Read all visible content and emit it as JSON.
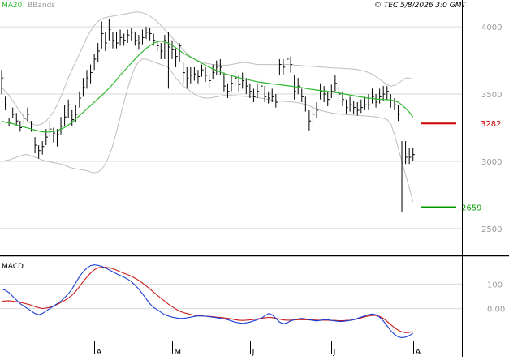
{
  "header": {
    "ma_label": "MA20",
    "bb_label": "BBands",
    "copyright": "© TEC 5/8/2026 3:0 GMT"
  },
  "colors": {
    "price_bar": "#000000",
    "ma20": "#2db82d",
    "bbands": "#bdbdbd",
    "resistance": "#cc0000",
    "support": "#009900",
    "macd_line": "#1f3fd6",
    "signal_line": "#cc1a1a",
    "grid": "#d9d9d9",
    "axis_label": "#999999",
    "frame": "#000000"
  },
  "chart_data": [
    {
      "type": "ohlc",
      "panel": "price",
      "title": "",
      "x": {
        "month_labels": [
          {
            "label": "A",
            "index": 25
          },
          {
            "label": "M",
            "index": 46
          },
          {
            "label": "J",
            "index": 67
          },
          {
            "label": "J",
            "index": 89
          },
          {
            "label": "A",
            "index": 111
          }
        ],
        "bar_count": 112
      },
      "y": {
        "ticks": [
          2500,
          3000,
          3500,
          4000
        ],
        "tick_labels": [
          "2500",
          "3000",
          "3500",
          "4000"
        ],
        "ylim": [
          2300,
          4200
        ]
      },
      "levels": {
        "resistance": {
          "value": 3282,
          "label": "3282"
        },
        "support": {
          "value": 2659,
          "label": "2659"
        }
      },
      "series": [
        {
          "name": "MA20",
          "values": [
            3300,
            3290,
            3285,
            3280,
            3270,
            3262,
            3255,
            3248,
            3240,
            3232,
            3225,
            3220,
            3218,
            3218,
            3222,
            3228,
            3238,
            3252,
            3270,
            3290,
            3315,
            3340,
            3365,
            3390,
            3415,
            3440,
            3465,
            3490,
            3515,
            3545,
            3575,
            3605,
            3640,
            3670,
            3700,
            3730,
            3760,
            3790,
            3815,
            3840,
            3860,
            3878,
            3890,
            3895,
            3890,
            3878,
            3862,
            3845,
            3825,
            3805,
            3790,
            3775,
            3760,
            3745,
            3730,
            3715,
            3700,
            3688,
            3676,
            3665,
            3655,
            3645,
            3637,
            3630,
            3622,
            3616,
            3610,
            3604,
            3598,
            3592,
            3588,
            3584,
            3580,
            3576,
            3573,
            3570,
            3566,
            3563,
            3560,
            3556,
            3552,
            3548,
            3543,
            3538,
            3534,
            3530,
            3527,
            3524,
            3520,
            3516,
            3512,
            3508,
            3503,
            3498,
            3493,
            3488,
            3483,
            3478,
            3474,
            3470,
            3467,
            3464,
            3462,
            3460,
            3458,
            3456,
            3450,
            3440,
            3420,
            3395,
            3365,
            3330
          ]
        },
        {
          "name": "BB upper",
          "values": [
            3550,
            3520,
            3490,
            3450,
            3410,
            3370,
            3330,
            3300,
            3280,
            3270,
            3270,
            3280,
            3300,
            3330,
            3370,
            3420,
            3480,
            3550,
            3620,
            3680,
            3740,
            3800,
            3860,
            3920,
            3970,
            4010,
            4040,
            4060,
            4070,
            4075,
            4080,
            4085,
            4090,
            4095,
            4100,
            4105,
            4110,
            4110,
            4105,
            4095,
            4080,
            4060,
            4040,
            4010,
            3980,
            3950,
            3920,
            3890,
            3860,
            3830,
            3800,
            3780,
            3760,
            3750,
            3740,
            3730,
            3725,
            3720,
            3718,
            3716,
            3715,
            3715,
            3720,
            3725,
            3730,
            3735,
            3735,
            3730,
            3725,
            3720,
            3720,
            3720,
            3720,
            3720,
            3720,
            3720,
            3720,
            3720,
            3718,
            3716,
            3714,
            3712,
            3710,
            3708,
            3706,
            3704,
            3702,
            3700,
            3698,
            3696,
            3694,
            3693,
            3692,
            3690,
            3688,
            3686,
            3682,
            3676,
            3670,
            3660,
            3648,
            3630,
            3610,
            3590,
            3570,
            3560,
            3565,
            3580,
            3600,
            3620,
            3620,
            3610
          ]
        },
        {
          "name": "BB lower",
          "values": [
            3000,
            3005,
            3010,
            3020,
            3030,
            3040,
            3050,
            3050,
            3040,
            3030,
            3020,
            3010,
            3000,
            2995,
            2990,
            2985,
            2980,
            2970,
            2960,
            2950,
            2945,
            2940,
            2935,
            2930,
            2920,
            2915,
            2920,
            2940,
            2980,
            3040,
            3120,
            3220,
            3330,
            3440,
            3540,
            3630,
            3700,
            3740,
            3760,
            3760,
            3750,
            3740,
            3730,
            3720,
            3710,
            3700,
            3660,
            3620,
            3590,
            3560,
            3540,
            3520,
            3500,
            3485,
            3475,
            3470,
            3470,
            3475,
            3480,
            3485,
            3490,
            3490,
            3490,
            3488,
            3486,
            3484,
            3482,
            3480,
            3478,
            3474,
            3470,
            3465,
            3460,
            3455,
            3450,
            3448,
            3446,
            3444,
            3442,
            3440,
            3436,
            3430,
            3422,
            3412,
            3400,
            3390,
            3380,
            3372,
            3366,
            3360,
            3356,
            3352,
            3350,
            3348,
            3346,
            3344,
            3342,
            3340,
            3338,
            3336,
            3334,
            3330,
            3325,
            3320,
            3310,
            3280,
            3200,
            3100,
            3000,
            2900,
            2800,
            2700
          ]
        }
      ],
      "close": [
        3620,
        3420,
        3290,
        3350,
        3300,
        3250,
        3320,
        3350,
        3260,
        3120,
        3080,
        3110,
        3180,
        3240,
        3210,
        3200,
        3260,
        3330,
        3420,
        3310,
        3350,
        3470,
        3550,
        3620,
        3660,
        3760,
        3820,
        3950,
        3880,
        3980,
        3900,
        3880,
        3920,
        3900,
        3940,
        3960,
        3900,
        3880,
        3920,
        3960,
        3950,
        3900,
        3860,
        3820,
        3900,
        3850,
        3830,
        3780,
        3860,
        3660,
        3620,
        3640,
        3650,
        3630,
        3680,
        3640,
        3600,
        3660,
        3700,
        3700,
        3560,
        3520,
        3580,
        3620,
        3570,
        3600,
        3560,
        3520,
        3480,
        3520,
        3560,
        3480,
        3470,
        3480,
        3440,
        3720,
        3700,
        3760,
        3720,
        3520,
        3560,
        3480,
        3420,
        3300,
        3350,
        3380,
        3520,
        3500,
        3460,
        3520,
        3580,
        3500,
        3460,
        3400,
        3420,
        3400,
        3380,
        3400,
        3420,
        3420,
        3480,
        3440,
        3480,
        3500,
        3520,
        3450,
        3420,
        3350,
        3100,
        3030,
        3030,
        3050
      ],
      "range": [
        [
          3500,
          3680
        ],
        [
          3380,
          3480
        ],
        [
          3260,
          3320
        ],
        [
          3320,
          3400
        ],
        [
          3260,
          3360
        ],
        [
          3220,
          3300
        ],
        [
          3280,
          3360
        ],
        [
          3300,
          3400
        ],
        [
          3220,
          3300
        ],
        [
          3060,
          3180
        ],
        [
          3020,
          3120
        ],
        [
          3050,
          3150
        ],
        [
          3120,
          3240
        ],
        [
          3180,
          3300
        ],
        [
          3140,
          3250
        ],
        [
          3110,
          3240
        ],
        [
          3200,
          3330
        ],
        [
          3260,
          3420
        ],
        [
          3320,
          3460
        ],
        [
          3260,
          3380
        ],
        [
          3290,
          3420
        ],
        [
          3400,
          3520
        ],
        [
          3480,
          3620
        ],
        [
          3540,
          3680
        ],
        [
          3580,
          3720
        ],
        [
          3680,
          3800
        ],
        [
          3740,
          3880
        ],
        [
          3840,
          4040
        ],
        [
          3820,
          3960
        ],
        [
          3900,
          4060
        ],
        [
          3840,
          3960
        ],
        [
          3840,
          3960
        ],
        [
          3860,
          3980
        ],
        [
          3860,
          3950
        ],
        [
          3880,
          3980
        ],
        [
          3900,
          3990
        ],
        [
          3860,
          3960
        ],
        [
          3830,
          3940
        ],
        [
          3870,
          3980
        ],
        [
          3910,
          4000
        ],
        [
          3900,
          3990
        ],
        [
          3860,
          3950
        ],
        [
          3820,
          3900
        ],
        [
          3760,
          3880
        ],
        [
          3760,
          3940
        ],
        [
          3540,
          3960
        ],
        [
          3760,
          3900
        ],
        [
          3700,
          3840
        ],
        [
          3740,
          3880
        ],
        [
          3580,
          3740
        ],
        [
          3540,
          3700
        ],
        [
          3580,
          3700
        ],
        [
          3600,
          3700
        ],
        [
          3580,
          3680
        ],
        [
          3630,
          3720
        ],
        [
          3590,
          3700
        ],
        [
          3550,
          3650
        ],
        [
          3610,
          3720
        ],
        [
          3640,
          3750
        ],
        [
          3640,
          3760
        ],
        [
          3520,
          3660
        ],
        [
          3470,
          3580
        ],
        [
          3520,
          3640
        ],
        [
          3560,
          3680
        ],
        [
          3520,
          3640
        ],
        [
          3540,
          3660
        ],
        [
          3500,
          3620
        ],
        [
          3470,
          3580
        ],
        [
          3440,
          3540
        ],
        [
          3470,
          3580
        ],
        [
          3510,
          3620
        ],
        [
          3440,
          3560
        ],
        [
          3430,
          3520
        ],
        [
          3440,
          3540
        ],
        [
          3400,
          3500
        ],
        [
          3640,
          3760
        ],
        [
          3640,
          3760
        ],
        [
          3700,
          3800
        ],
        [
          3660,
          3780
        ],
        [
          3460,
          3640
        ],
        [
          3500,
          3620
        ],
        [
          3440,
          3540
        ],
        [
          3370,
          3480
        ],
        [
          3230,
          3380
        ],
        [
          3280,
          3420
        ],
        [
          3320,
          3440
        ],
        [
          3460,
          3580
        ],
        [
          3440,
          3560
        ],
        [
          3410,
          3520
        ],
        [
          3470,
          3570
        ],
        [
          3520,
          3640
        ],
        [
          3450,
          3560
        ],
        [
          3410,
          3520
        ],
        [
          3350,
          3460
        ],
        [
          3370,
          3480
        ],
        [
          3350,
          3450
        ],
        [
          3340,
          3440
        ],
        [
          3360,
          3460
        ],
        [
          3380,
          3480
        ],
        [
          3380,
          3500
        ],
        [
          3430,
          3540
        ],
        [
          3400,
          3500
        ],
        [
          3430,
          3540
        ],
        [
          3450,
          3560
        ],
        [
          3460,
          3560
        ],
        [
          3400,
          3500
        ],
        [
          3380,
          3470
        ],
        [
          3300,
          3420
        ],
        [
          2620,
          3150
        ],
        [
          2980,
          3150
        ],
        [
          2980,
          3100
        ],
        [
          3000,
          3100
        ]
      ]
    },
    {
      "type": "line",
      "panel": "macd",
      "title": "MACD",
      "y": {
        "ticks": [
          0,
          100
        ],
        "tick_labels": [
          "0.00",
          "100"
        ],
        "ylim": [
          -130,
          210
        ]
      },
      "series": [
        {
          "name": "MACD",
          "values": [
            80,
            75,
            65,
            50,
            35,
            20,
            10,
            0,
            -10,
            -20,
            -25,
            -20,
            -10,
            0,
            10,
            20,
            30,
            45,
            60,
            80,
            105,
            130,
            150,
            165,
            175,
            178,
            176,
            172,
            165,
            158,
            150,
            142,
            135,
            128,
            120,
            110,
            95,
            80,
            60,
            40,
            20,
            5,
            -5,
            -15,
            -25,
            -30,
            -35,
            -38,
            -40,
            -40,
            -38,
            -35,
            -32,
            -30,
            -30,
            -31,
            -33,
            -35,
            -37,
            -40,
            -42,
            -45,
            -50,
            -55,
            -58,
            -60,
            -58,
            -55,
            -50,
            -45,
            -40,
            -30,
            -20,
            -25,
            -40,
            -55,
            -62,
            -58,
            -50,
            -45,
            -42,
            -40,
            -42,
            -45,
            -48,
            -50,
            -48,
            -45,
            -45,
            -48,
            -50,
            -52,
            -52,
            -50,
            -48,
            -45,
            -40,
            -35,
            -30,
            -25,
            -22,
            -25,
            -35,
            -50,
            -70,
            -90,
            -105,
            -115,
            -118,
            -116,
            -110,
            -100
          ]
        },
        {
          "name": "Signal",
          "values": [
            30,
            31,
            32,
            30,
            28,
            25,
            22,
            18,
            14,
            8,
            4,
            0,
            2,
            5,
            10,
            17,
            25,
            33,
            43,
            55,
            70,
            90,
            110,
            128,
            145,
            158,
            166,
            168,
            168,
            166,
            162,
            157,
            150,
            144,
            138,
            132,
            124,
            115,
            104,
            92,
            80,
            67,
            55,
            42,
            30,
            18,
            8,
            -2,
            -10,
            -16,
            -20,
            -24,
            -27,
            -29,
            -30,
            -31,
            -32,
            -33,
            -35,
            -36,
            -38,
            -40,
            -42,
            -45,
            -47,
            -48,
            -47,
            -46,
            -44,
            -42,
            -40,
            -38,
            -36,
            -37,
            -40,
            -43,
            -46,
            -47,
            -47,
            -46,
            -45,
            -45,
            -45,
            -46,
            -46,
            -47,
            -47,
            -47,
            -47,
            -48,
            -48,
            -49,
            -49,
            -48,
            -47,
            -45,
            -42,
            -38,
            -34,
            -30,
            -28,
            -28,
            -32,
            -40,
            -52,
            -65,
            -78,
            -88,
            -95,
            -98,
            -97,
            -94
          ]
        }
      ]
    }
  ]
}
